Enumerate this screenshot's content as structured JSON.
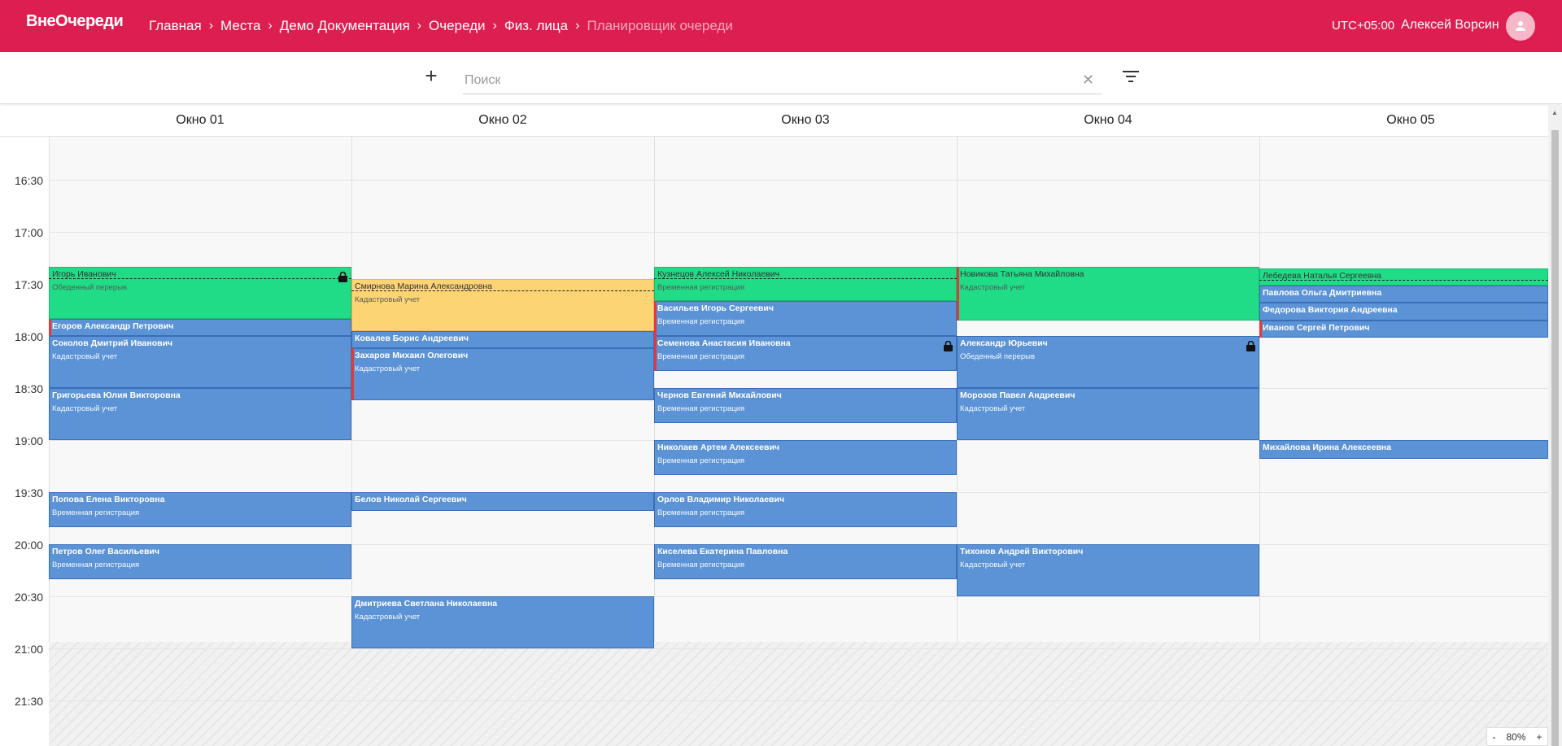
{
  "header": {
    "logo": "ВнеОчереди",
    "breadcrumbs": [
      "Главная",
      "Места",
      "Демо Документация",
      "Очереди",
      "Физ. лица"
    ],
    "current": "Планировщик очереди",
    "timezone": "UTC+05:00",
    "user": "Алексей Ворсин"
  },
  "toolbar": {
    "search_placeholder": "Поиск",
    "search_value": ""
  },
  "columns": [
    "Окно 01",
    "Окно 02",
    "Окно 03",
    "Окно 04",
    "Окно 05"
  ],
  "times": [
    "16:30",
    "17:00",
    "17:30",
    "18:00",
    "18:30",
    "19:00",
    "19:30",
    "20:00",
    "20:30",
    "21:00",
    "21:30"
  ],
  "events": [
    {
      "col": 0,
      "start": "17:20",
      "end": "17:50",
      "name": "Игорь Иванович",
      "sub": "Обеденный перерыв",
      "color": "green",
      "lock": true,
      "dash": true
    },
    {
      "col": 0,
      "start": "17:50",
      "end": "18:00",
      "name": "Егоров Александр Петрович",
      "sub": "",
      "color": "blue",
      "red": true
    },
    {
      "col": 0,
      "start": "18:00",
      "end": "18:30",
      "name": "Соколов Дмитрий Иванович",
      "sub": "Кадастровый учет",
      "color": "blue"
    },
    {
      "col": 0,
      "start": "18:30",
      "end": "19:00",
      "name": "Григорьева Юлия Викторовна",
      "sub": "Кадастровый учет",
      "color": "blue"
    },
    {
      "col": 0,
      "start": "19:30",
      "end": "19:50",
      "name": "Попова Елена Викторовна",
      "sub": "Временная регистрация",
      "color": "blue"
    },
    {
      "col": 0,
      "start": "20:00",
      "end": "20:20",
      "name": "Петров Олег Васильевич",
      "sub": "Временная регистрация",
      "color": "blue"
    },
    {
      "col": 1,
      "start": "17:27",
      "end": "17:57",
      "name": "Смирнова Марина Александровна",
      "sub": "Кадастровый учет",
      "color": "yellow",
      "dash": true
    },
    {
      "col": 1,
      "start": "17:57",
      "end": "18:07",
      "name": "Ковалев Борис Андреевич",
      "sub": "",
      "color": "blue"
    },
    {
      "col": 1,
      "start": "18:07",
      "end": "18:37",
      "name": "Захаров Михаил Олегович",
      "sub": "Кадастровый учет",
      "color": "blue",
      "red": true
    },
    {
      "col": 1,
      "start": "19:30",
      "end": "19:41",
      "name": "Белов Николай Сергеевич",
      "sub": "–",
      "color": "blue"
    },
    {
      "col": 1,
      "start": "20:30",
      "end": "21:00",
      "name": "Дмитриева Светлана Николаевна",
      "sub": "Кадастровый учет",
      "color": "blue"
    },
    {
      "col": 2,
      "start": "17:20",
      "end": "17:40",
      "name": "Кузнецов Алексей Николаевич",
      "sub": "Временная регистрация",
      "color": "green",
      "dash": true
    },
    {
      "col": 2,
      "start": "17:40",
      "end": "18:00",
      "name": "Васильев Игорь Сергеевич",
      "sub": "Временная регистрация",
      "color": "blue",
      "red": true
    },
    {
      "col": 2,
      "start": "18:00",
      "end": "18:20",
      "name": "Семенова Анастасия Ивановна",
      "sub": "Временная регистрация",
      "color": "blue",
      "lock": true,
      "red": true
    },
    {
      "col": 2,
      "start": "18:30",
      "end": "18:50",
      "name": "Чернов Евгений Михайлович",
      "sub": "Временная регистрация",
      "color": "blue"
    },
    {
      "col": 2,
      "start": "19:00",
      "end": "19:20",
      "name": "Николаев Артем Алексеевич",
      "sub": "Временная регистрация",
      "color": "blue"
    },
    {
      "col": 2,
      "start": "19:30",
      "end": "19:50",
      "name": "Орлов Владимир Николаевич",
      "sub": "Временная регистрация",
      "color": "blue"
    },
    {
      "col": 2,
      "start": "20:00",
      "end": "20:20",
      "name": "Киселева Екатерина Павловна",
      "sub": "Временная регистрация",
      "color": "blue"
    },
    {
      "col": 3,
      "start": "17:20",
      "end": "17:51",
      "name": "Новикова Татьяна Михайловна",
      "sub": "Кадастровый учет",
      "color": "green",
      "red": true
    },
    {
      "col": 3,
      "start": "18:00",
      "end": "18:30",
      "name": "Александр Юрьевич",
      "sub": "Обеденный перерыв",
      "color": "blue",
      "lock": true
    },
    {
      "col": 3,
      "start": "18:30",
      "end": "19:00",
      "name": "Морозов Павел Андреевич",
      "sub": "Кадастровый учет",
      "color": "blue"
    },
    {
      "col": 3,
      "start": "20:00",
      "end": "20:30",
      "name": "Тихонов Андрей Викторович",
      "sub": "Кадастровый учет",
      "color": "blue"
    },
    {
      "col": 4,
      "start": "17:21",
      "end": "17:31",
      "name": "Лебедева Наталья Сергеевна",
      "sub": "",
      "color": "green",
      "dash": true
    },
    {
      "col": 4,
      "start": "17:31",
      "end": "17:41",
      "name": "Павлова Ольга Дмитриевна",
      "sub": "",
      "color": "blue"
    },
    {
      "col": 4,
      "start": "17:41",
      "end": "17:51",
      "name": "Федорова Виктория Андреевна",
      "sub": "",
      "color": "blue"
    },
    {
      "col": 4,
      "start": "17:51",
      "end": "18:01",
      "name": "Иванов Сергей Петрович",
      "sub": "–",
      "color": "blue",
      "red": true
    },
    {
      "col": 4,
      "start": "19:00",
      "end": "19:11",
      "name": "Михайлова Ирина Алексеевна",
      "sub": "–",
      "color": "blue"
    }
  ],
  "zoom": {
    "minus": "-",
    "value": "80%",
    "plus": "+"
  }
}
